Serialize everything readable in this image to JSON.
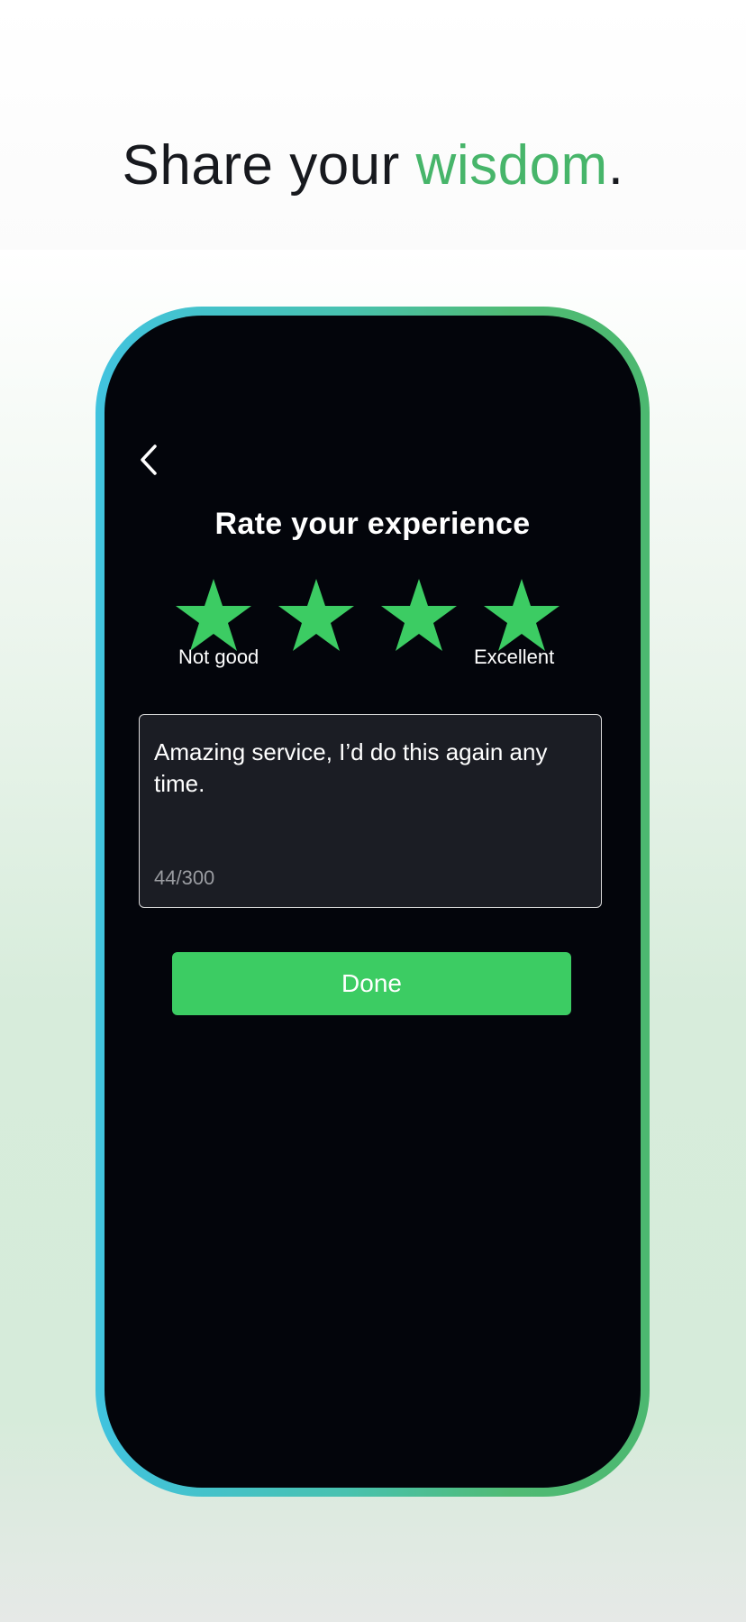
{
  "headline": {
    "prefix": "Share your ",
    "accent": "wisdom",
    "suffix": "."
  },
  "screen": {
    "back_icon": "chevron-left-icon",
    "title": "Rate your experience",
    "rating": {
      "selected": 4,
      "max": 4,
      "low_label": "Not good",
      "high_label": "Excellent"
    },
    "comment": {
      "value": "Amazing service, I’d do this again any time.",
      "counter": "44/300"
    },
    "done_label": "Done"
  },
  "colors": {
    "accent_green": "#47b56a",
    "star_green": "#3ccc63",
    "button_green": "#3ccc63",
    "screen_bg": "#03050b",
    "frame_cyan": "#41c3df",
    "frame_green": "#4cb870"
  }
}
